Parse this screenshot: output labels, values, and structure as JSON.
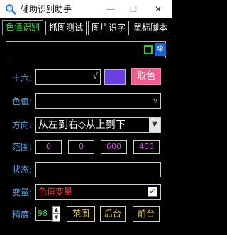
{
  "window": {
    "title": "辅助识别助手",
    "app_icon": "magnifier-icon",
    "minimize_glyph": "—",
    "maximize_glyph": "☐",
    "close_glyph": "✕"
  },
  "tabs": [
    {
      "label": "色值识别",
      "active": true
    },
    {
      "label": "抓图测试",
      "active": false
    },
    {
      "label": "图片识字",
      "active": false
    },
    {
      "label": "鼠标脚本",
      "active": false
    }
  ],
  "topbar": {
    "value": "",
    "snow_glyph": "❄"
  },
  "hex": {
    "label": "十六:",
    "value": "",
    "swatch_color": "#6a3fe0",
    "button": "取色",
    "signature_glyph": "√"
  },
  "color_value": {
    "label": "色值:",
    "value": "",
    "signature_glyph": "√"
  },
  "direction": {
    "label": "方向:",
    "selected": "从左到右◇从上到下",
    "arrow": "▼"
  },
  "range": {
    "label": "范围:",
    "values": [
      "0",
      "0",
      "600",
      "400"
    ]
  },
  "status": {
    "label": "状态:",
    "value": ""
  },
  "variable": {
    "label": "变量:",
    "value": "色值变量",
    "checked": true,
    "check_glyph": "✔"
  },
  "precision": {
    "label": "精度:",
    "value": "98",
    "up": "▲",
    "down": "▼"
  },
  "buttons": {
    "range": "范围",
    "background": "后台",
    "foreground": "前台"
  },
  "colors": {
    "label_blue": "#4aa3e8",
    "tab_active": "#25e825",
    "range_num": "#d050e0",
    "button_text": "#f3d13a",
    "variable_text": "#ff3b3b"
  }
}
